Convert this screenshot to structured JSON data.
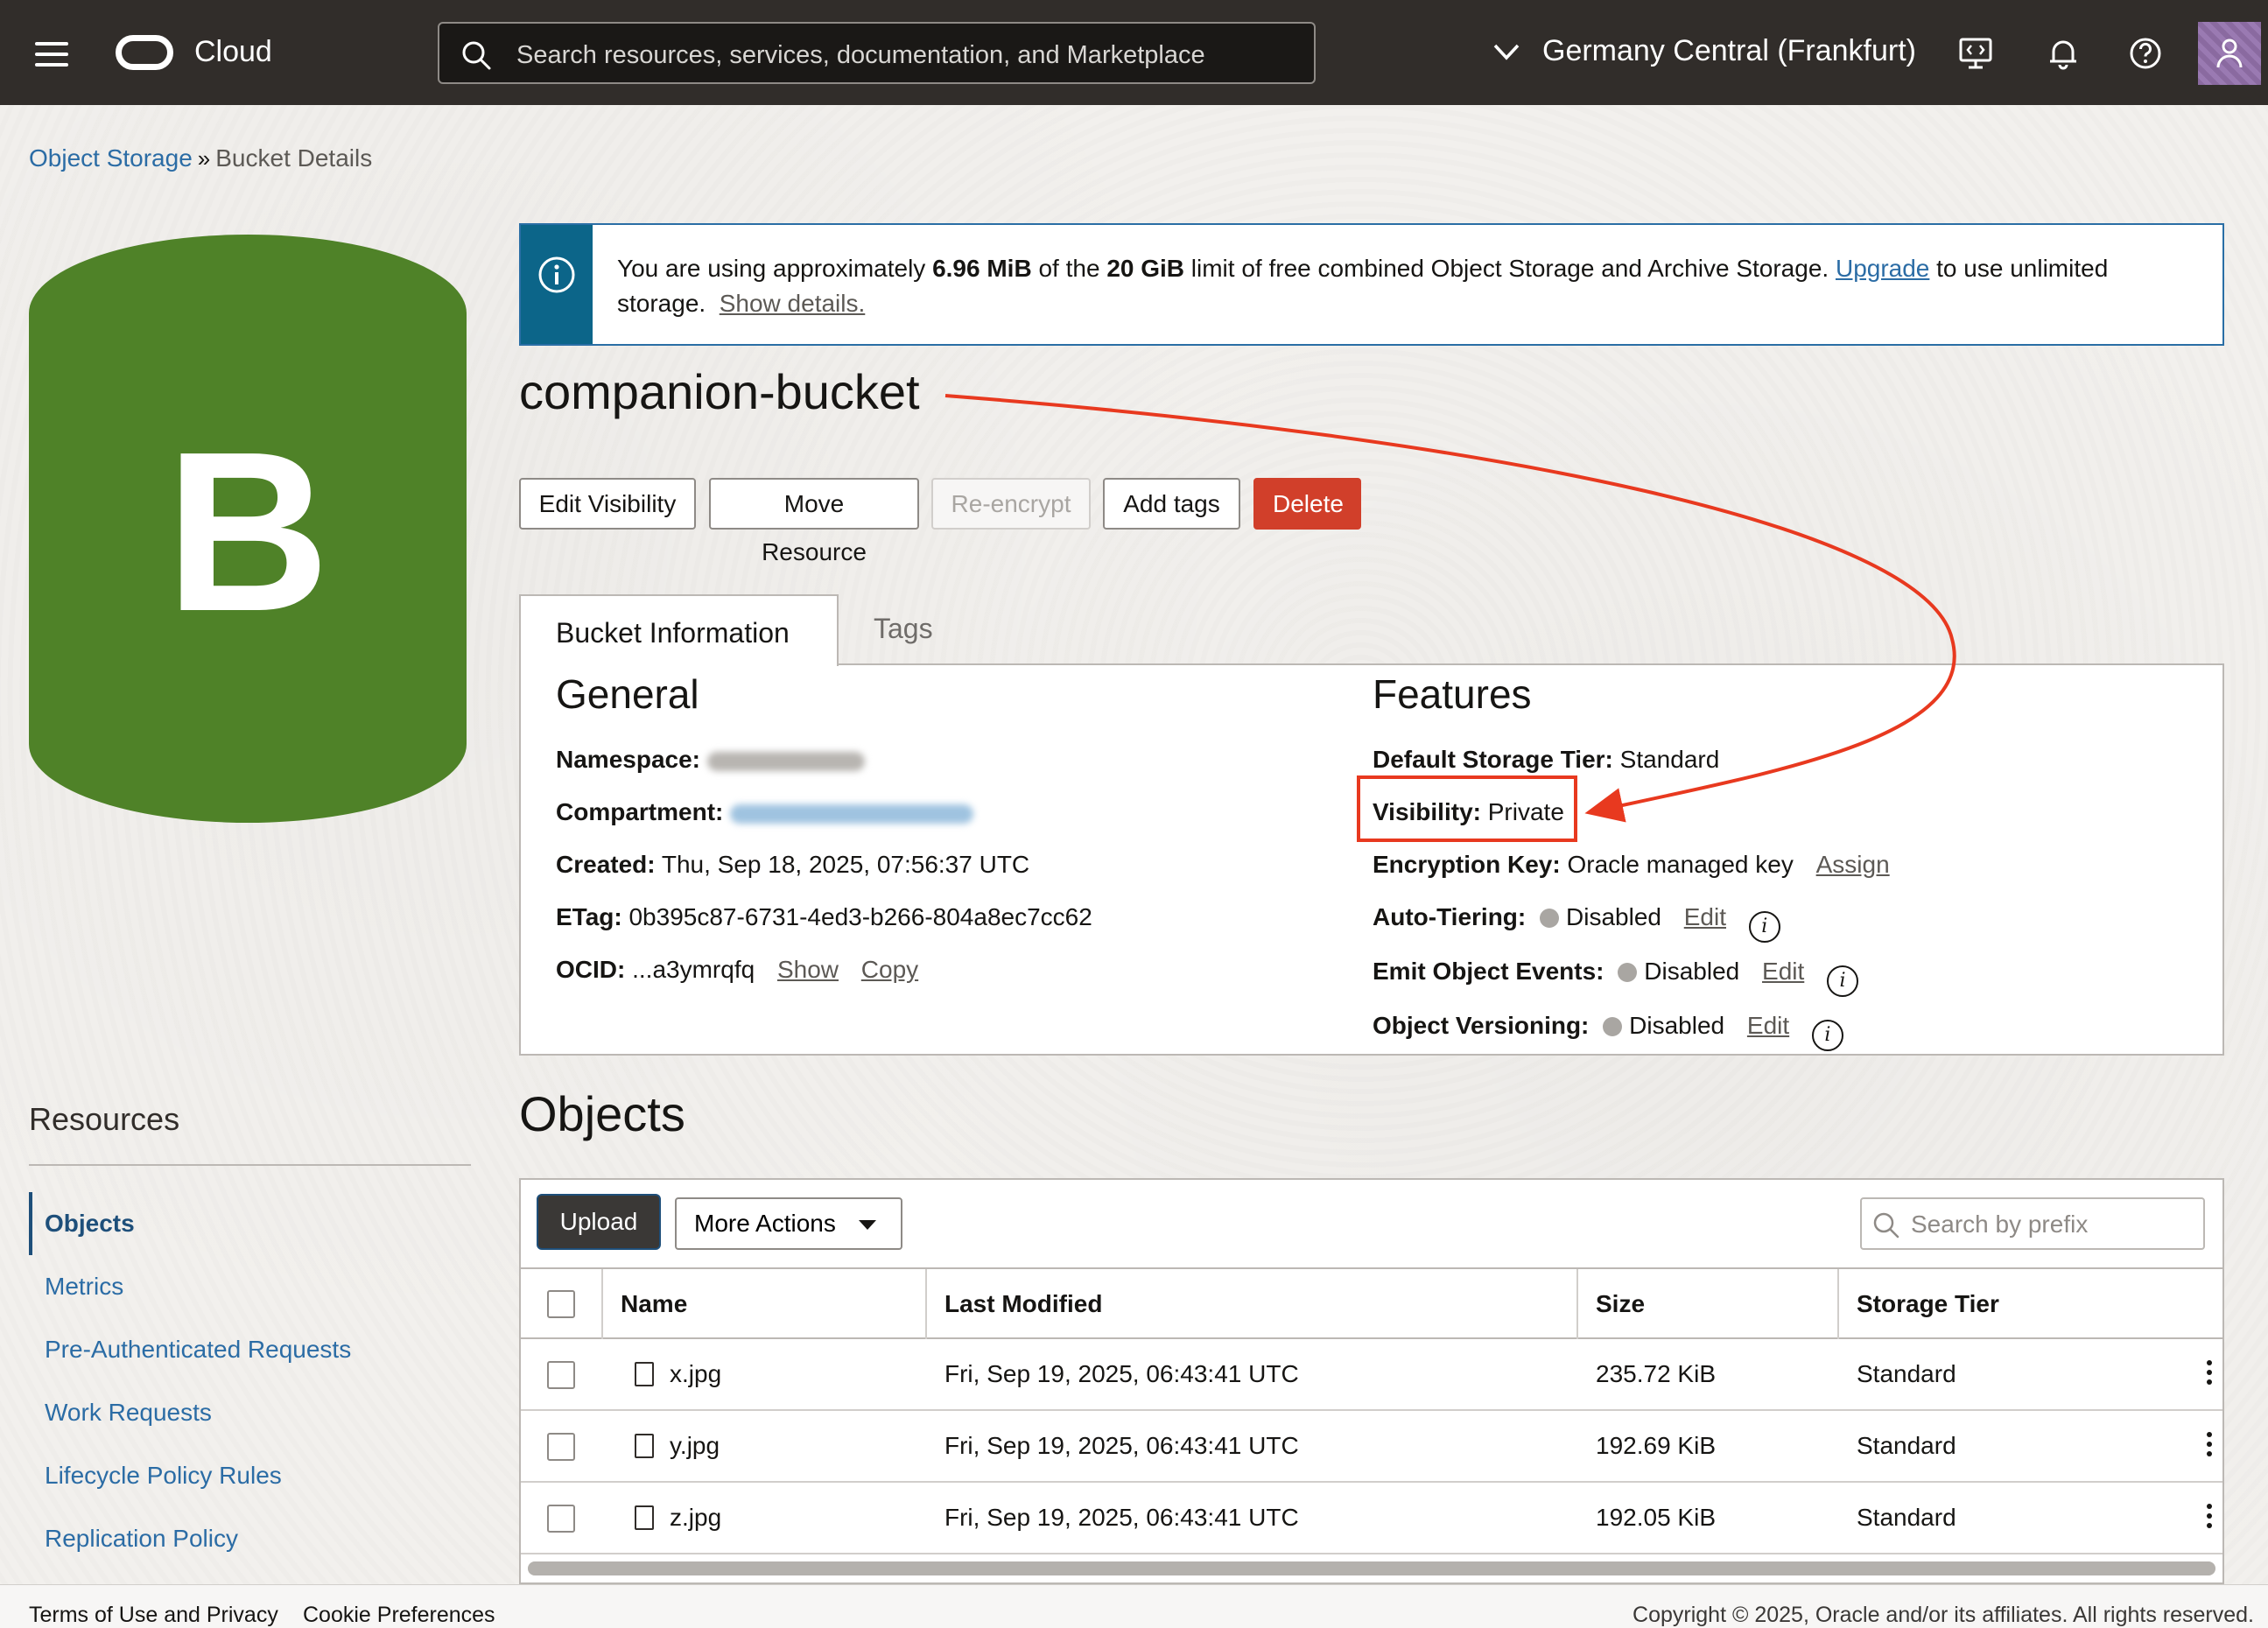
{
  "header": {
    "app_name": "Cloud",
    "search_placeholder": "Search resources, services, documentation, and Marketplace",
    "region": "Germany Central (Frankfurt)"
  },
  "breadcrumb": {
    "parent": "Object Storage",
    "separator": "»",
    "current": "Bucket Details"
  },
  "bucket_icon_letter": "B",
  "banner": {
    "text_1": "You are using approximately ",
    "used": "6.96 MiB",
    "text_2": " of the ",
    "limit": "20 GiB",
    "text_3": " limit of free combined Object Storage and Archive Storage. ",
    "upgrade_link": "Upgrade",
    "text_4": " to use unlimited storage.",
    "details_link": "Show details."
  },
  "bucket_name": "companion-bucket",
  "actions": {
    "edit_visibility": "Edit Visibility",
    "move_resource": "Move Resource",
    "re_encrypt": "Re-encrypt",
    "add_tags": "Add tags",
    "delete": "Delete"
  },
  "tabs": {
    "bucket_information": "Bucket Information",
    "tags": "Tags"
  },
  "general": {
    "heading": "General",
    "namespace_label": "Namespace:",
    "compartment_label": "Compartment:",
    "created_label": "Created:",
    "created_value": "Thu, Sep 18, 2025, 07:56:37 UTC",
    "etag_label": "ETag:",
    "etag_value": "0b395c87-6731-4ed3-b266-804a8ec7cc62",
    "ocid_label": "OCID:",
    "ocid_value": "...a3ymrqfq",
    "show_link": "Show",
    "copy_link": "Copy"
  },
  "features": {
    "heading": "Features",
    "storage_tier_label": "Default Storage Tier:",
    "storage_tier_value": "Standard",
    "visibility_label": "Visibility:",
    "visibility_value": "Private",
    "encryption_label": "Encryption Key:",
    "encryption_value": "Oracle managed key",
    "assign_link": "Assign",
    "auto_tiering_label": "Auto-Tiering:",
    "auto_tiering_value": "Disabled",
    "emit_events_label": "Emit Object Events:",
    "emit_events_value": "Disabled",
    "versioning_label": "Object Versioning:",
    "versioning_value": "Disabled",
    "edit_link": "Edit"
  },
  "resources": {
    "title": "Resources",
    "items": [
      "Objects",
      "Metrics",
      "Pre-Authenticated Requests",
      "Work Requests",
      "Lifecycle Policy Rules",
      "Replication Policy"
    ]
  },
  "objects": {
    "title": "Objects",
    "upload": "Upload",
    "more_actions": "More Actions",
    "search_placeholder": "Search by prefix",
    "columns": [
      "Name",
      "Last Modified",
      "Size",
      "Storage Tier"
    ],
    "rows": [
      {
        "name": "x.jpg",
        "modified": "Fri, Sep 19, 2025, 06:43:41 UTC",
        "size": "235.72 KiB",
        "tier": "Standard"
      },
      {
        "name": "y.jpg",
        "modified": "Fri, Sep 19, 2025, 06:43:41 UTC",
        "size": "192.69 KiB",
        "tier": "Standard"
      },
      {
        "name": "z.jpg",
        "modified": "Fri, Sep 19, 2025, 06:43:41 UTC",
        "size": "192.05 KiB",
        "tier": "Standard"
      }
    ]
  },
  "footer": {
    "terms": "Terms of Use and Privacy",
    "cookies": "Cookie Preferences",
    "copyright": "Copyright © 2025, Oracle and/or its affiliates. All rights reserved."
  },
  "colors": {
    "header_bg": "#312d2a",
    "bucket_green": "#4f8228",
    "banner_accent": "#0c6589",
    "link_blue": "#2b6ca5",
    "delete_red": "#d13f2a",
    "annotation_red": "#e8391f"
  }
}
